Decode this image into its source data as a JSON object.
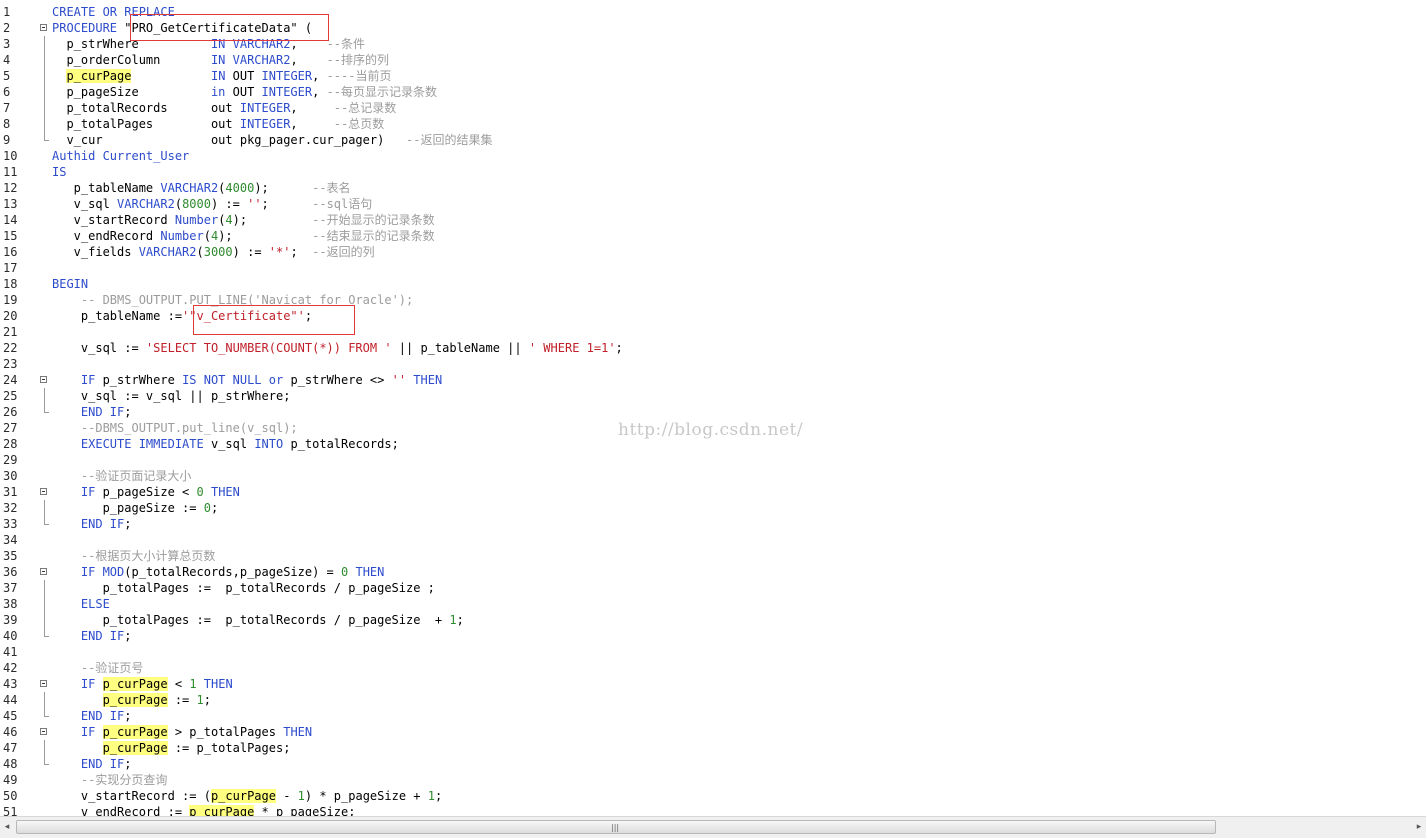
{
  "lines": [
    {
      "n": "1",
      "t": [
        {
          "k": "k",
          "v": "CREATE OR REPLACE"
        }
      ]
    },
    {
      "n": "2",
      "fold": "start",
      "t": [
        {
          "k": "k",
          "v": "PROCEDURE "
        },
        {
          "k": "p",
          "v": "\"PRO_GetCertificateData\" ("
        }
      ]
    },
    {
      "n": "3",
      "fold": "bar",
      "t": [
        {
          "k": "p",
          "v": "  p_strWhere          "
        },
        {
          "k": "k",
          "v": "IN VARCHAR2"
        },
        {
          "k": "p",
          "v": ",    "
        },
        {
          "k": "c",
          "v": "--条件"
        }
      ]
    },
    {
      "n": "4",
      "fold": "bar",
      "t": [
        {
          "k": "p",
          "v": "  p_orderColumn       "
        },
        {
          "k": "k",
          "v": "IN VARCHAR2"
        },
        {
          "k": "p",
          "v": ",    "
        },
        {
          "k": "c",
          "v": "--排序的列"
        }
      ]
    },
    {
      "n": "5",
      "fold": "bar",
      "t": [
        {
          "k": "p",
          "v": "  "
        },
        {
          "k": "h",
          "v": "p_curPage"
        },
        {
          "k": "p",
          "v": "           "
        },
        {
          "k": "k",
          "v": "IN"
        },
        {
          "k": "p",
          "v": " OUT "
        },
        {
          "k": "k",
          "v": "INTEGER"
        },
        {
          "k": "p",
          "v": ", "
        },
        {
          "k": "c",
          "v": "----当前页"
        }
      ]
    },
    {
      "n": "6",
      "fold": "bar",
      "t": [
        {
          "k": "p",
          "v": "  p_pageSize          "
        },
        {
          "k": "k",
          "v": "in"
        },
        {
          "k": "p",
          "v": " OUT "
        },
        {
          "k": "k",
          "v": "INTEGER"
        },
        {
          "k": "p",
          "v": ", "
        },
        {
          "k": "c",
          "v": "--每页显示记录条数"
        }
      ]
    },
    {
      "n": "7",
      "fold": "bar",
      "t": [
        {
          "k": "p",
          "v": "  p_totalRecords      out "
        },
        {
          "k": "k",
          "v": "INTEGER"
        },
        {
          "k": "p",
          "v": ",     "
        },
        {
          "k": "c",
          "v": "--总记录数"
        }
      ]
    },
    {
      "n": "8",
      "fold": "bar",
      "t": [
        {
          "k": "p",
          "v": "  p_totalPages        out "
        },
        {
          "k": "k",
          "v": "INTEGER"
        },
        {
          "k": "p",
          "v": ",     "
        },
        {
          "k": "c",
          "v": "--总页数"
        }
      ]
    },
    {
      "n": "9",
      "fold": "end",
      "t": [
        {
          "k": "p",
          "v": "  v_cur               out pkg_pager.cur_pager)   "
        },
        {
          "k": "c",
          "v": "--返回的结果集"
        }
      ]
    },
    {
      "n": "10",
      "t": [
        {
          "k": "k",
          "v": "Authid Current_User"
        }
      ]
    },
    {
      "n": "11",
      "t": [
        {
          "k": "k",
          "v": "IS"
        }
      ]
    },
    {
      "n": "12",
      "t": [
        {
          "k": "p",
          "v": "   p_tableName "
        },
        {
          "k": "k",
          "v": "VARCHAR2"
        },
        {
          "k": "p",
          "v": "("
        },
        {
          "k": "n",
          "v": "4000"
        },
        {
          "k": "p",
          "v": ");      "
        },
        {
          "k": "c",
          "v": "--表名"
        }
      ]
    },
    {
      "n": "13",
      "t": [
        {
          "k": "p",
          "v": "   v_sql "
        },
        {
          "k": "k",
          "v": "VARCHAR2"
        },
        {
          "k": "p",
          "v": "("
        },
        {
          "k": "n",
          "v": "8000"
        },
        {
          "k": "p",
          "v": ") := "
        },
        {
          "k": "s",
          "v": "''"
        },
        {
          "k": "p",
          "v": ";      "
        },
        {
          "k": "c",
          "v": "--sql语句"
        }
      ]
    },
    {
      "n": "14",
      "t": [
        {
          "k": "p",
          "v": "   v_startRecord "
        },
        {
          "k": "k",
          "v": "Number"
        },
        {
          "k": "p",
          "v": "("
        },
        {
          "k": "n",
          "v": "4"
        },
        {
          "k": "p",
          "v": ");         "
        },
        {
          "k": "c",
          "v": "--开始显示的记录条数"
        }
      ]
    },
    {
      "n": "15",
      "t": [
        {
          "k": "p",
          "v": "   v_endRecord "
        },
        {
          "k": "k",
          "v": "Number"
        },
        {
          "k": "p",
          "v": "("
        },
        {
          "k": "n",
          "v": "4"
        },
        {
          "k": "p",
          "v": ");           "
        },
        {
          "k": "c",
          "v": "--结束显示的记录条数"
        }
      ]
    },
    {
      "n": "16",
      "t": [
        {
          "k": "p",
          "v": "   v_fields "
        },
        {
          "k": "k",
          "v": "VARCHAR2"
        },
        {
          "k": "p",
          "v": "("
        },
        {
          "k": "n",
          "v": "3000"
        },
        {
          "k": "p",
          "v": ") := "
        },
        {
          "k": "s",
          "v": "'*'"
        },
        {
          "k": "p",
          "v": ";  "
        },
        {
          "k": "c",
          "v": "--返回的列"
        }
      ]
    },
    {
      "n": "17",
      "t": []
    },
    {
      "n": "18",
      "t": [
        {
          "k": "k",
          "v": "BEGIN"
        }
      ]
    },
    {
      "n": "19",
      "t": [
        {
          "k": "p",
          "v": "    "
        },
        {
          "k": "c",
          "v": "-- DBMS_OUTPUT.PUT_LINE('Navicat for Oracle');"
        }
      ]
    },
    {
      "n": "20",
      "t": [
        {
          "k": "p",
          "v": "    p_tableName :="
        },
        {
          "k": "s",
          "v": "'\"v_Certificate\"'"
        },
        {
          "k": "p",
          "v": ";"
        }
      ]
    },
    {
      "n": "21",
      "t": []
    },
    {
      "n": "22",
      "t": [
        {
          "k": "p",
          "v": "    v_sql := "
        },
        {
          "k": "s",
          "v": "'SELECT TO_NUMBER(COUNT(*)) FROM '"
        },
        {
          "k": "p",
          "v": " || p_tableName || "
        },
        {
          "k": "s",
          "v": "' WHERE 1=1'"
        },
        {
          "k": "p",
          "v": ";"
        }
      ]
    },
    {
      "n": "23",
      "t": []
    },
    {
      "n": "24",
      "fold": "start",
      "t": [
        {
          "k": "p",
          "v": "    "
        },
        {
          "k": "k",
          "v": "IF"
        },
        {
          "k": "p",
          "v": " p_strWhere "
        },
        {
          "k": "k",
          "v": "IS NOT NULL or"
        },
        {
          "k": "p",
          "v": " p_strWhere <> "
        },
        {
          "k": "s",
          "v": "''"
        },
        {
          "k": "p",
          "v": " "
        },
        {
          "k": "k",
          "v": "THEN"
        }
      ]
    },
    {
      "n": "25",
      "fold": "bar",
      "t": [
        {
          "k": "p",
          "v": "    v_sql := v_sql || p_strWhere;"
        }
      ]
    },
    {
      "n": "26",
      "fold": "end",
      "t": [
        {
          "k": "p",
          "v": "    "
        },
        {
          "k": "k",
          "v": "END IF"
        },
        {
          "k": "p",
          "v": ";"
        }
      ]
    },
    {
      "n": "27",
      "t": [
        {
          "k": "p",
          "v": "    "
        },
        {
          "k": "c",
          "v": "--DBMS_OUTPUT.put_line(v_sql);"
        }
      ]
    },
    {
      "n": "28",
      "t": [
        {
          "k": "p",
          "v": "    "
        },
        {
          "k": "k",
          "v": "EXECUTE IMMEDIATE"
        },
        {
          "k": "p",
          "v": " v_sql "
        },
        {
          "k": "k",
          "v": "INTO"
        },
        {
          "k": "p",
          "v": " p_totalRecords;"
        }
      ]
    },
    {
      "n": "29",
      "t": []
    },
    {
      "n": "30",
      "t": [
        {
          "k": "p",
          "v": "    "
        },
        {
          "k": "c",
          "v": "--验证页面记录大小"
        }
      ]
    },
    {
      "n": "31",
      "fold": "start",
      "t": [
        {
          "k": "p",
          "v": "    "
        },
        {
          "k": "k",
          "v": "IF"
        },
        {
          "k": "p",
          "v": " p_pageSize < "
        },
        {
          "k": "n",
          "v": "0"
        },
        {
          "k": "p",
          "v": " "
        },
        {
          "k": "k",
          "v": "THEN"
        }
      ]
    },
    {
      "n": "32",
      "fold": "bar",
      "t": [
        {
          "k": "p",
          "v": "       p_pageSize := "
        },
        {
          "k": "n",
          "v": "0"
        },
        {
          "k": "p",
          "v": ";"
        }
      ]
    },
    {
      "n": "33",
      "fold": "end",
      "t": [
        {
          "k": "p",
          "v": "    "
        },
        {
          "k": "k",
          "v": "END IF"
        },
        {
          "k": "p",
          "v": ";"
        }
      ]
    },
    {
      "n": "34",
      "t": []
    },
    {
      "n": "35",
      "t": [
        {
          "k": "p",
          "v": "    "
        },
        {
          "k": "c",
          "v": "--根据页大小计算总页数"
        }
      ]
    },
    {
      "n": "36",
      "fold": "start",
      "t": [
        {
          "k": "p",
          "v": "    "
        },
        {
          "k": "k",
          "v": "IF MOD"
        },
        {
          "k": "p",
          "v": "(p_totalRecords,p_pageSize) = "
        },
        {
          "k": "n",
          "v": "0"
        },
        {
          "k": "p",
          "v": " "
        },
        {
          "k": "k",
          "v": "THEN"
        }
      ]
    },
    {
      "n": "37",
      "fold": "bar",
      "t": [
        {
          "k": "p",
          "v": "       p_totalPages :=  p_totalRecords / p_pageSize ;"
        }
      ]
    },
    {
      "n": "38",
      "fold": "bar",
      "t": [
        {
          "k": "p",
          "v": "    "
        },
        {
          "k": "k",
          "v": "ELSE"
        }
      ]
    },
    {
      "n": "39",
      "fold": "bar",
      "t": [
        {
          "k": "p",
          "v": "       p_totalPages :=  p_totalRecords / p_pageSize  + "
        },
        {
          "k": "n",
          "v": "1"
        },
        {
          "k": "p",
          "v": ";"
        }
      ]
    },
    {
      "n": "40",
      "fold": "end",
      "t": [
        {
          "k": "p",
          "v": "    "
        },
        {
          "k": "k",
          "v": "END IF"
        },
        {
          "k": "p",
          "v": ";"
        }
      ]
    },
    {
      "n": "41",
      "t": []
    },
    {
      "n": "42",
      "t": [
        {
          "k": "p",
          "v": "    "
        },
        {
          "k": "c",
          "v": "--验证页号"
        }
      ]
    },
    {
      "n": "43",
      "fold": "start",
      "t": [
        {
          "k": "p",
          "v": "    "
        },
        {
          "k": "k",
          "v": "IF"
        },
        {
          "k": "p",
          "v": " "
        },
        {
          "k": "h",
          "v": "p_curPage"
        },
        {
          "k": "p",
          "v": " < "
        },
        {
          "k": "n",
          "v": "1"
        },
        {
          "k": "p",
          "v": " "
        },
        {
          "k": "k",
          "v": "THEN"
        }
      ]
    },
    {
      "n": "44",
      "fold": "bar",
      "t": [
        {
          "k": "p",
          "v": "       "
        },
        {
          "k": "h",
          "v": "p_curPage"
        },
        {
          "k": "p",
          "v": " := "
        },
        {
          "k": "n",
          "v": "1"
        },
        {
          "k": "p",
          "v": ";"
        }
      ]
    },
    {
      "n": "45",
      "fold": "end",
      "t": [
        {
          "k": "p",
          "v": "    "
        },
        {
          "k": "k",
          "v": "END IF"
        },
        {
          "k": "p",
          "v": ";"
        }
      ]
    },
    {
      "n": "46",
      "fold": "start",
      "t": [
        {
          "k": "p",
          "v": "    "
        },
        {
          "k": "k",
          "v": "IF"
        },
        {
          "k": "p",
          "v": " "
        },
        {
          "k": "h",
          "v": "p_curPage"
        },
        {
          "k": "p",
          "v": " > p_totalPages "
        },
        {
          "k": "k",
          "v": "THEN"
        }
      ]
    },
    {
      "n": "47",
      "fold": "bar",
      "t": [
        {
          "k": "p",
          "v": "       "
        },
        {
          "k": "h",
          "v": "p_curPage"
        },
        {
          "k": "p",
          "v": " := p_totalPages;"
        }
      ]
    },
    {
      "n": "48",
      "fold": "end",
      "t": [
        {
          "k": "p",
          "v": "    "
        },
        {
          "k": "k",
          "v": "END IF"
        },
        {
          "k": "p",
          "v": ";"
        }
      ]
    },
    {
      "n": "49",
      "t": [
        {
          "k": "p",
          "v": "    "
        },
        {
          "k": "c",
          "v": "--实现分页查询"
        }
      ]
    },
    {
      "n": "50",
      "t": [
        {
          "k": "p",
          "v": "    v_startRecord := ("
        },
        {
          "k": "h",
          "v": "p_curPage"
        },
        {
          "k": "p",
          "v": " - "
        },
        {
          "k": "n",
          "v": "1"
        },
        {
          "k": "p",
          "v": ") * p_pageSize + "
        },
        {
          "k": "n",
          "v": "1"
        },
        {
          "k": "p",
          "v": ";"
        }
      ]
    },
    {
      "n": "51",
      "t": [
        {
          "k": "p",
          "v": "    v_endRecord := "
        },
        {
          "k": "h",
          "v": "p_curPage"
        },
        {
          "k": "p",
          "v": " * p_pageSize;"
        }
      ]
    }
  ],
  "watermark": "http://blog.csdn.net/",
  "scrollbar": {
    "left_arrow": "◂",
    "right_arrow": "▸",
    "grip": "|||"
  },
  "colors": {
    "keyword": "#2d4ccc",
    "string": "#c0202a",
    "number": "#2e8b2e",
    "comment": "#9c9c9c",
    "highlight": "#ffff80",
    "annotation_box": "#e03a3a"
  }
}
